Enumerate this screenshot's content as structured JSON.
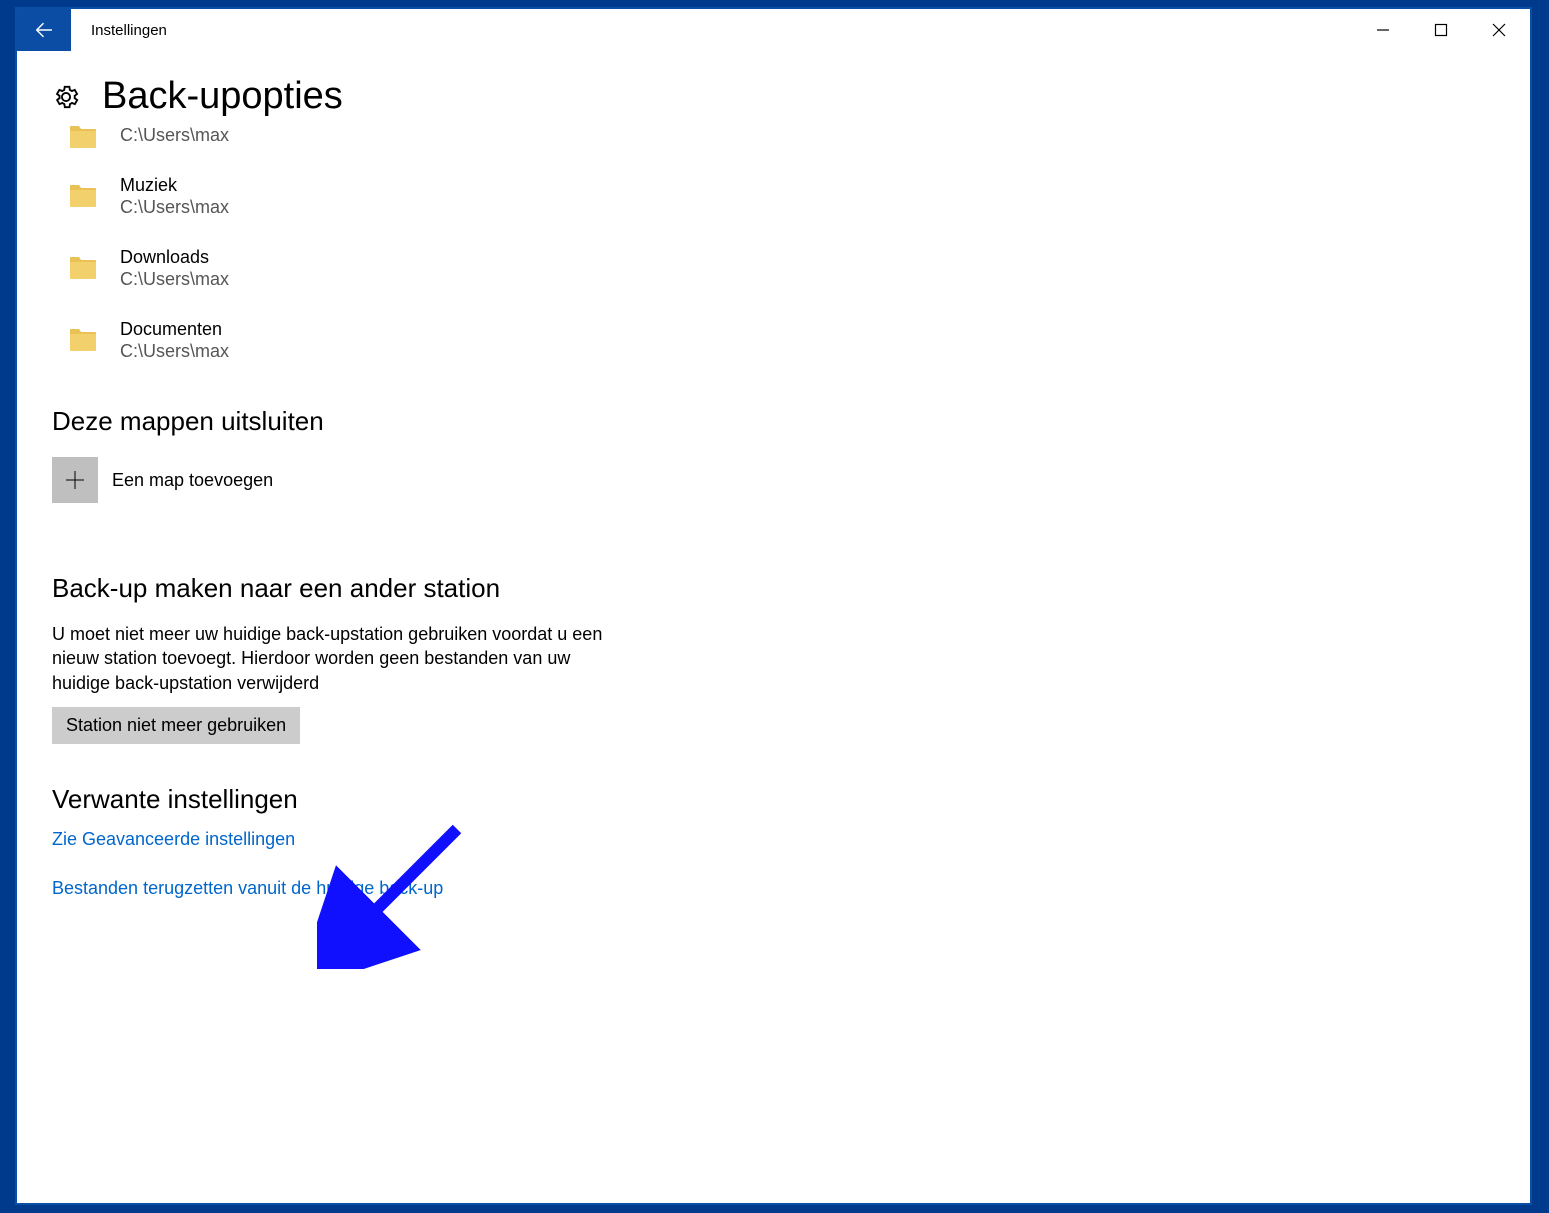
{
  "window_title": "Instellingen",
  "page_title": "Back-upopties",
  "folders": [
    {
      "name": "",
      "path": "C:\\Users\\max"
    },
    {
      "name": "Muziek",
      "path": "C:\\Users\\max"
    },
    {
      "name": "Downloads",
      "path": "C:\\Users\\max"
    },
    {
      "name": "Documenten",
      "path": "C:\\Users\\max"
    }
  ],
  "exclude_heading": "Deze mappen uitsluiten",
  "add_folder_label": "Een map toevoegen",
  "drive_heading": "Back-up maken naar een ander station",
  "drive_body": "U moet niet meer uw huidige back-upstation gebruiken voordat u een nieuw station toevoegt. Hierdoor worden geen bestanden van uw huidige back-upstation verwijderd",
  "stop_button": "Station niet meer gebruiken",
  "related_heading": "Verwante instellingen",
  "link_advanced": "Zie Geavanceerde instellingen",
  "link_restore": "Bestanden terugzetten vanuit de huidige back-up"
}
